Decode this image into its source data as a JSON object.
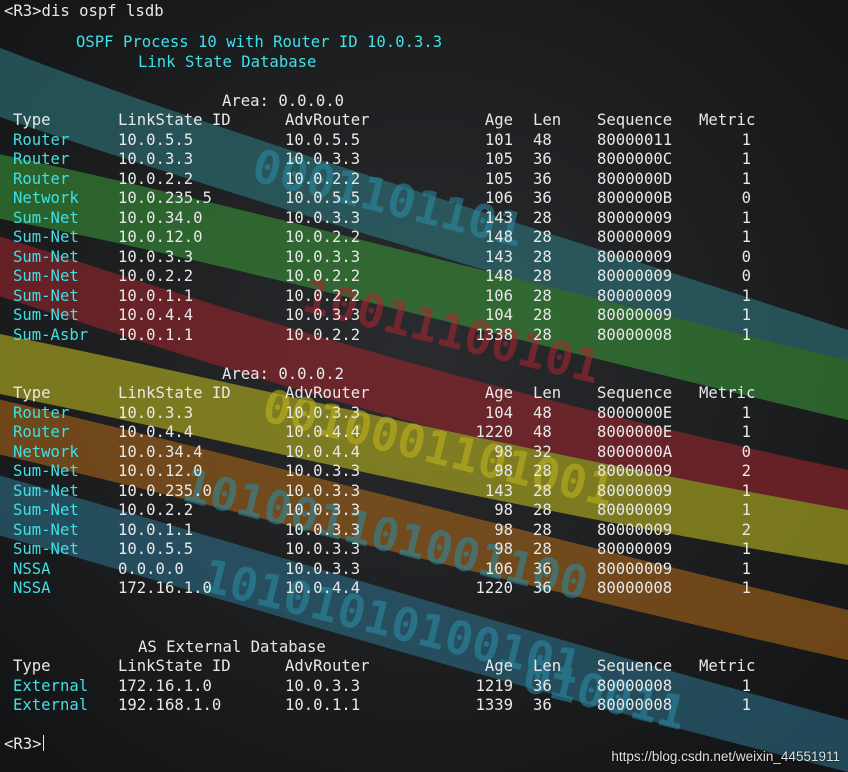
{
  "command_prompt": "<R3>dis ospf lsdb",
  "header": {
    "process_line": "OSPF Process 10 with Router ID 10.0.3.3",
    "title": "Link State Database"
  },
  "areas": [
    {
      "label": "Area: 0.0.0.0",
      "columns": [
        "Type",
        "LinkState ID",
        "AdvRouter",
        "Age",
        "Len",
        "Sequence",
        "Metric"
      ],
      "rows": [
        [
          "Router",
          "10.0.5.5",
          "10.0.5.5",
          "101",
          "48",
          "80000011",
          "1"
        ],
        [
          "Router",
          "10.0.3.3",
          "10.0.3.3",
          "105",
          "36",
          "8000000C",
          "1"
        ],
        [
          "Router",
          "10.0.2.2",
          "10.0.2.2",
          "105",
          "36",
          "8000000D",
          "1"
        ],
        [
          "Network",
          "10.0.235.5",
          "10.0.5.5",
          "106",
          "36",
          "8000000B",
          "0"
        ],
        [
          "Sum-Net",
          "10.0.34.0",
          "10.0.3.3",
          "143",
          "28",
          "80000009",
          "1"
        ],
        [
          "Sum-Net",
          "10.0.12.0",
          "10.0.2.2",
          "148",
          "28",
          "80000009",
          "1"
        ],
        [
          "Sum-Net",
          "10.0.3.3",
          "10.0.3.3",
          "143",
          "28",
          "80000009",
          "0"
        ],
        [
          "Sum-Net",
          "10.0.2.2",
          "10.0.2.2",
          "148",
          "28",
          "80000009",
          "0"
        ],
        [
          "Sum-Net",
          "10.0.1.1",
          "10.0.2.2",
          "106",
          "28",
          "80000009",
          "1"
        ],
        [
          "Sum-Net",
          "10.0.4.4",
          "10.0.3.3",
          "104",
          "28",
          "80000009",
          "1"
        ],
        [
          "Sum-Asbr",
          "10.0.1.1",
          "10.0.2.2",
          "1338",
          "28",
          "80000008",
          "1"
        ]
      ]
    },
    {
      "label": "Area: 0.0.0.2",
      "columns": [
        "Type",
        "LinkState ID",
        "AdvRouter",
        "Age",
        "Len",
        "Sequence",
        "Metric"
      ],
      "rows": [
        [
          "Router",
          "10.0.3.3",
          "10.0.3.3",
          "104",
          "48",
          "8000000E",
          "1"
        ],
        [
          "Router",
          "10.0.4.4",
          "10.0.4.4",
          "1220",
          "48",
          "8000000E",
          "1"
        ],
        [
          "Network",
          "10.0.34.4",
          "10.0.4.4",
          "98",
          "32",
          "8000000A",
          "0"
        ],
        [
          "Sum-Net",
          "10.0.12.0",
          "10.0.3.3",
          "98",
          "28",
          "80000009",
          "2"
        ],
        [
          "Sum-Net",
          "10.0.235.0",
          "10.0.3.3",
          "143",
          "28",
          "80000009",
          "1"
        ],
        [
          "Sum-Net",
          "10.0.2.2",
          "10.0.3.3",
          "98",
          "28",
          "80000009",
          "1"
        ],
        [
          "Sum-Net",
          "10.0.1.1",
          "10.0.3.3",
          "98",
          "28",
          "80000009",
          "2"
        ],
        [
          "Sum-Net",
          "10.0.5.5",
          "10.0.3.3",
          "98",
          "28",
          "80000009",
          "1"
        ],
        [
          "NSSA",
          "0.0.0.0",
          "10.0.3.3",
          "106",
          "36",
          "80000009",
          "1"
        ],
        [
          "NSSA",
          "172.16.1.0",
          "10.0.4.4",
          "1220",
          "36",
          "80000008",
          "1"
        ]
      ]
    }
  ],
  "external": {
    "title": "AS External Database",
    "columns": [
      "Type",
      "LinkState ID",
      "AdvRouter",
      "Age",
      "Len",
      "Sequence",
      "Metric"
    ],
    "rows": [
      [
        "External",
        "172.16.1.0",
        "10.0.3.3",
        "1219",
        "36",
        "80000008",
        "1"
      ],
      [
        "External",
        "192.168.1.0",
        "10.0.1.1",
        "1339",
        "36",
        "80000008",
        "1"
      ]
    ]
  },
  "end_prompt": "<R3>",
  "watermark": "https://blog.csdn.net/weixin_44551911",
  "colors": {
    "background": "#1c1d1f",
    "text": "#e8e8e8",
    "highlight": "#3fe0e6"
  }
}
